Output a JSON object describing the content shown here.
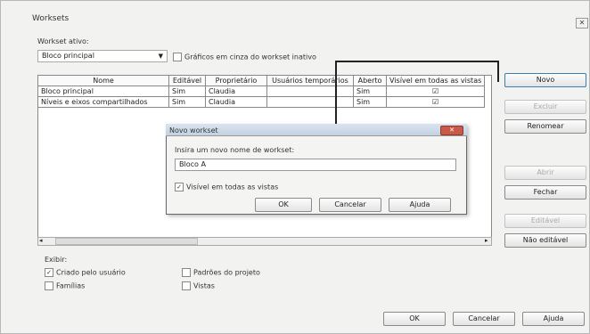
{
  "window": {
    "title": "Worksets",
    "close": "✕"
  },
  "active_label": "Workset ativo:",
  "active_value": "Bloco principal",
  "gray_inactive": "Gráficos em cinza do workset inativo",
  "columns": [
    "Nome",
    "Editável",
    "Proprietário",
    "Usuários temporários",
    "Aberto",
    "Visível em todas as vistas"
  ],
  "rows": [
    [
      "Bloco principal",
      "Sim",
      "Claudia",
      "",
      "Sim",
      "☑"
    ],
    [
      "Níveis e eixos compartilhados",
      "Sim",
      "Claudia",
      "",
      "Sim",
      "☑"
    ]
  ],
  "side_buttons": {
    "novo": "Novo",
    "excluir": "Excluir",
    "renomear": "Renomear",
    "abrir": "Abrir",
    "fechar": "Fechar",
    "editavel": "Editável",
    "nao_editavel": "Não editável"
  },
  "show_label": "Exibir:",
  "show_options": {
    "user": "Criado pelo usuário",
    "standards": "Padrões do projeto",
    "families": "Famílias",
    "views": "Vistas"
  },
  "bottom_buttons": {
    "ok": "OK",
    "cancel": "Cancelar",
    "help": "Ajuda"
  },
  "dialog": {
    "title": "Novo workset",
    "prompt": "Insira um novo nome de workset:",
    "value": "Bloco A",
    "visible_all": "Visível em todas as vistas",
    "ok": "OK",
    "cancel": "Cancelar",
    "help": "Ajuda"
  }
}
